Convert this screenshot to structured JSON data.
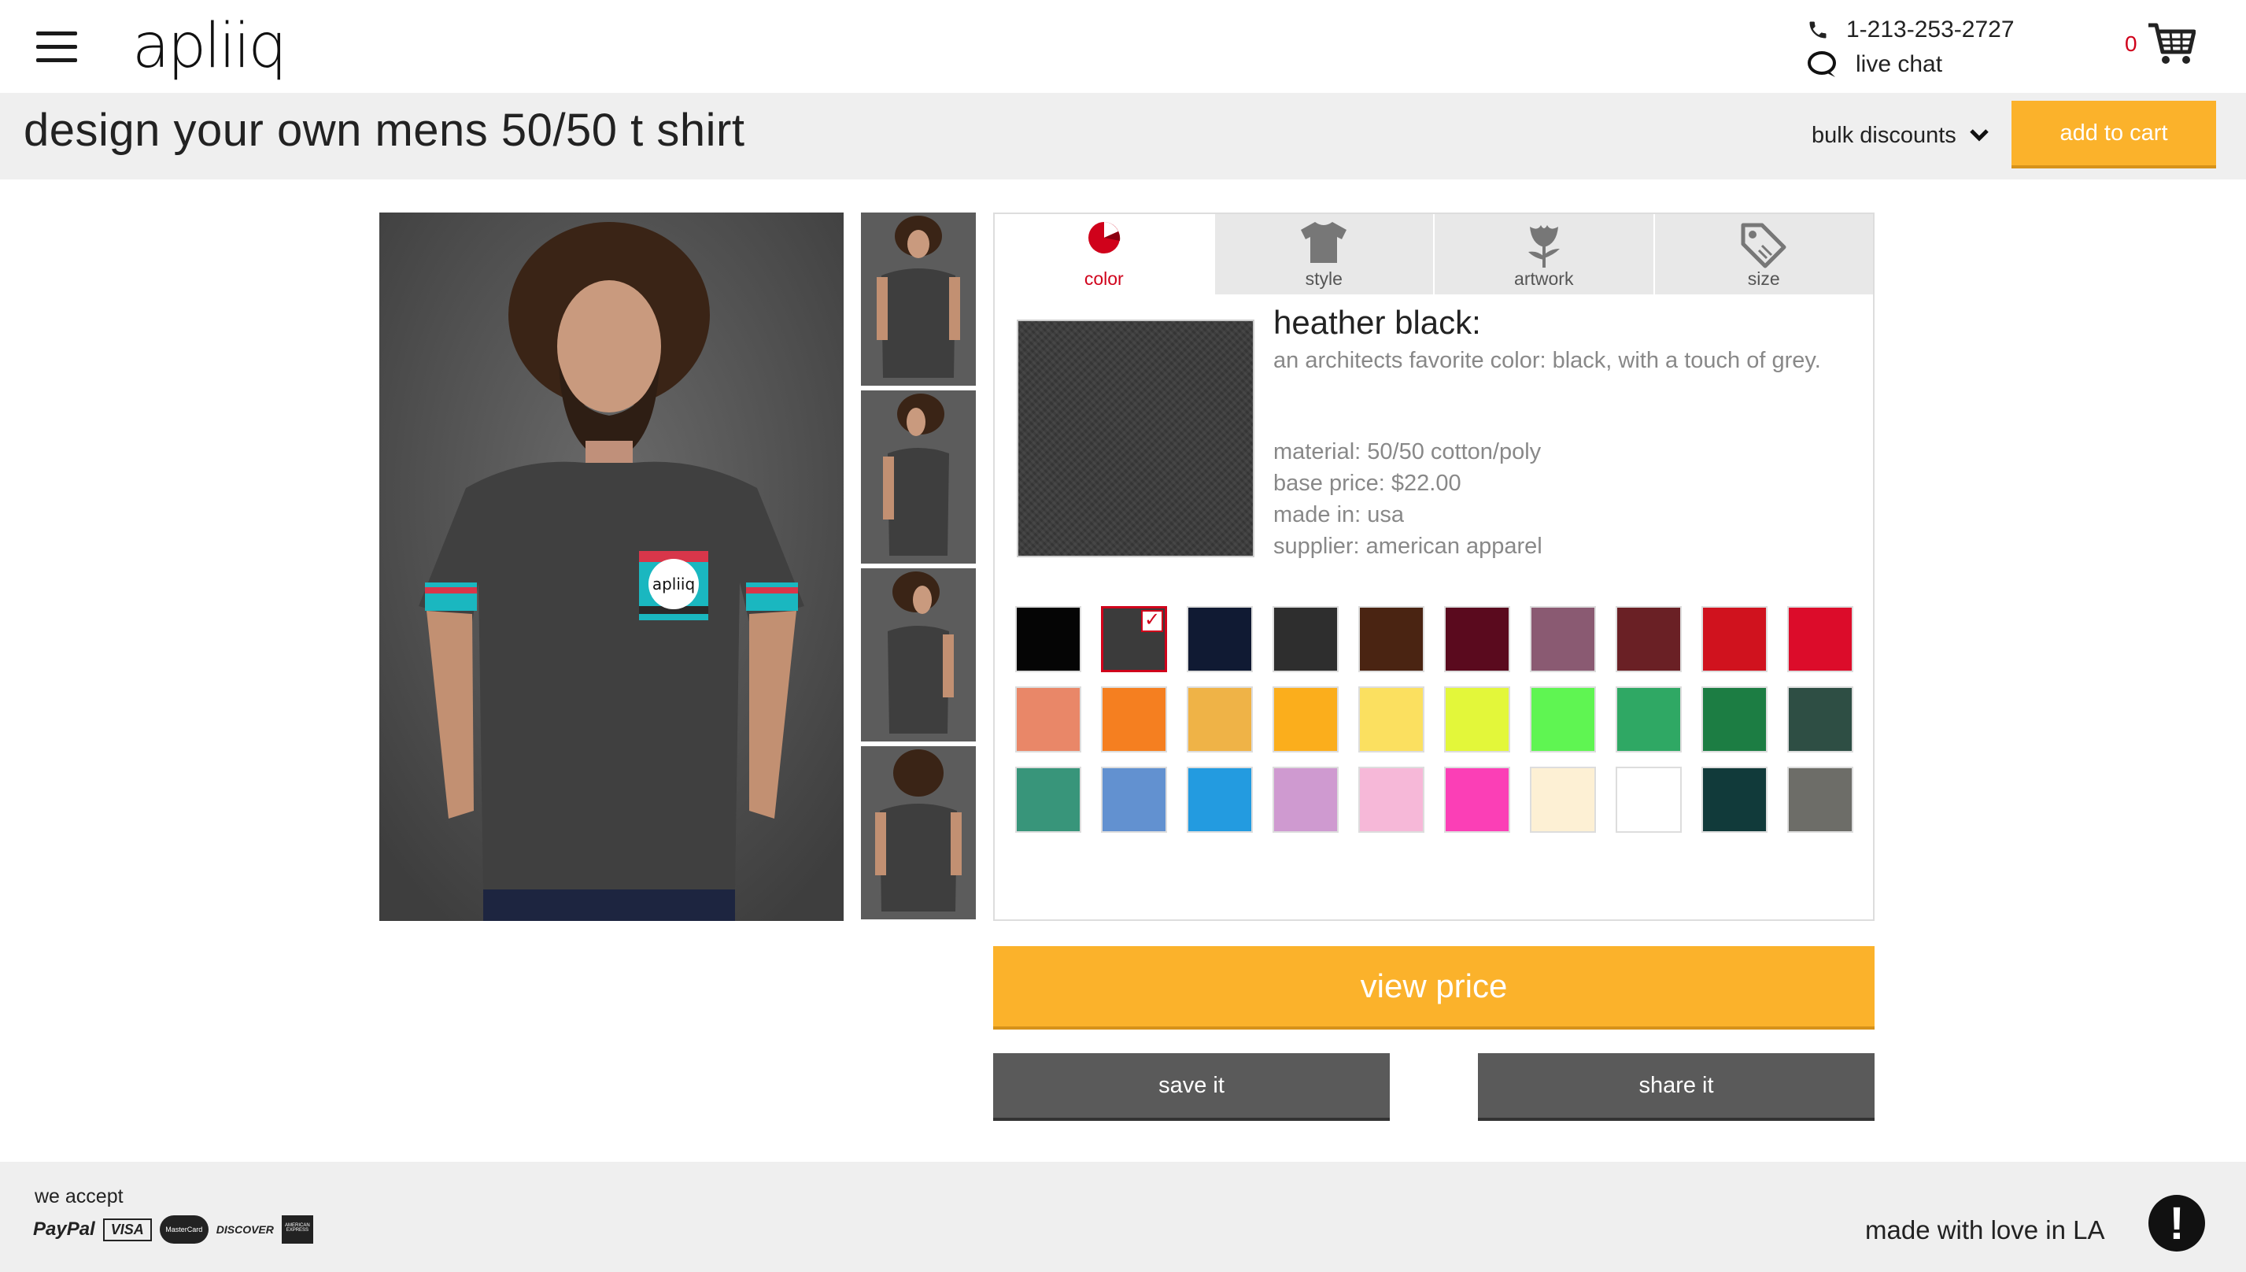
{
  "header": {
    "logo_text": "apliiq",
    "phone": "1-213-253-2727",
    "chat": "live chat",
    "cart_count": "0"
  },
  "titlebar": {
    "title": "design your own mens 50/50 t shirt",
    "bulk_label": "bulk discounts",
    "add_to_cart": "add to cart"
  },
  "tabs": [
    {
      "label": "color",
      "icon": "color-wheel-icon",
      "active": true
    },
    {
      "label": "style",
      "icon": "tshirt-icon",
      "active": false
    },
    {
      "label": "artwork",
      "icon": "flower-icon",
      "active": false
    },
    {
      "label": "size",
      "icon": "tag-icon",
      "active": false
    }
  ],
  "selected_color": {
    "name": "heather black:",
    "description": "an architects favorite color: black, with a touch of grey.",
    "material": "material: 50/50 cotton/poly",
    "base_price": "base price: $22.00",
    "made_in": "made in: usa",
    "supplier": "supplier: american apparel"
  },
  "swatches": [
    "#050505",
    "#3b3b3b",
    "#101a33",
    "#2e2e2e",
    "#4a2412",
    "#5a0a1e",
    "#8a5a72",
    "#6a2025",
    "#d0121e",
    "#dc0c2a",
    "#e98768",
    "#f57f20",
    "#efb347",
    "#fbae1c",
    "#fbe060",
    "#e3f73a",
    "#5ff552",
    "#2fa864",
    "#1c7d43",
    "#2e4e44",
    "#38957a",
    "#6291d0",
    "#239be0",
    "#cf9ad0",
    "#f6b8d8",
    "#fb3fb6",
    "#fdf0d4",
    "#ffffff",
    "#113a3a",
    "#6d6d68"
  ],
  "selected_swatch_index": 1,
  "buttons": {
    "view_price": "view price",
    "save": "save it",
    "share": "share it"
  },
  "footer": {
    "we_accept": "we accept",
    "payments": [
      "PayPal",
      "VISA",
      "MasterCard",
      "DISCOVER",
      "AMERICAN EXPRESS"
    ],
    "love": "made with love in LA"
  }
}
